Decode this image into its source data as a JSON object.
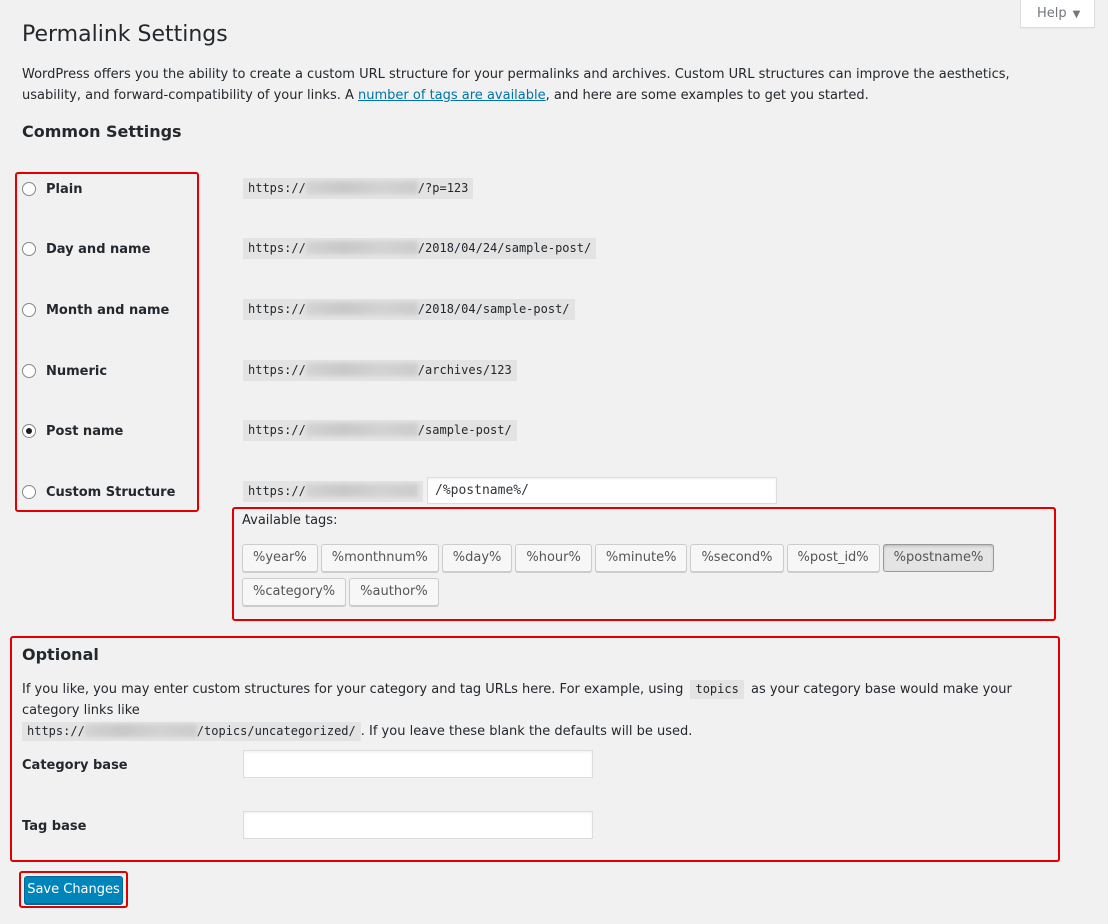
{
  "help_tab": {
    "label": "Help",
    "icon": "caret-down-icon"
  },
  "page_title": "Permalink Settings",
  "intro": {
    "before_link": "WordPress offers you the ability to create a custom URL structure for your permalinks and archives. Custom URL structures can improve the aesthetics, usability, and forward-compatibility of your links. A ",
    "link_text": "number of tags are available",
    "after_link": ", and here are some examples to get you started."
  },
  "common_settings": {
    "heading": "Common Settings",
    "url_prefix": "https://",
    "options": [
      {
        "label": "Plain",
        "example_suffix": "/?p=123",
        "checked": false
      },
      {
        "label": "Day and name",
        "example_suffix": "/2018/04/24/sample-post/",
        "checked": false
      },
      {
        "label": "Month and name",
        "example_suffix": "/2018/04/sample-post/",
        "checked": false
      },
      {
        "label": "Numeric",
        "example_suffix": "/archives/123",
        "checked": false
      },
      {
        "label": "Post name",
        "example_suffix": "/sample-post/",
        "checked": true
      },
      {
        "label": "Custom Structure",
        "example_suffix": "",
        "checked": false
      }
    ],
    "custom_structure_value": "/%postname%/",
    "available_tags_label": "Available tags:",
    "tags": [
      "%year%",
      "%monthnum%",
      "%day%",
      "%hour%",
      "%minute%",
      "%second%",
      "%post_id%",
      "%postname%",
      "%category%",
      "%author%"
    ],
    "active_tag": "%postname%"
  },
  "optional": {
    "heading": "Optional",
    "desc_part1": "If you like, you may enter custom structures for your category and tag URLs here. For example, using",
    "desc_code1": "topics",
    "desc_part2": "as your category base would make your category links like",
    "desc_code2_prefix": "https://",
    "desc_code2_suffix": "/topics/uncategorized/",
    "desc_part3": ". If you leave these blank the defaults will be used.",
    "category_base_label": "Category base",
    "category_base_value": "",
    "tag_base_label": "Tag base",
    "tag_base_value": ""
  },
  "save_button": "Save Changes",
  "colors": {
    "accent": "#0085ba",
    "link": "#0073aa",
    "highlight_border": "#e00000",
    "background": "#f1f1f1"
  }
}
